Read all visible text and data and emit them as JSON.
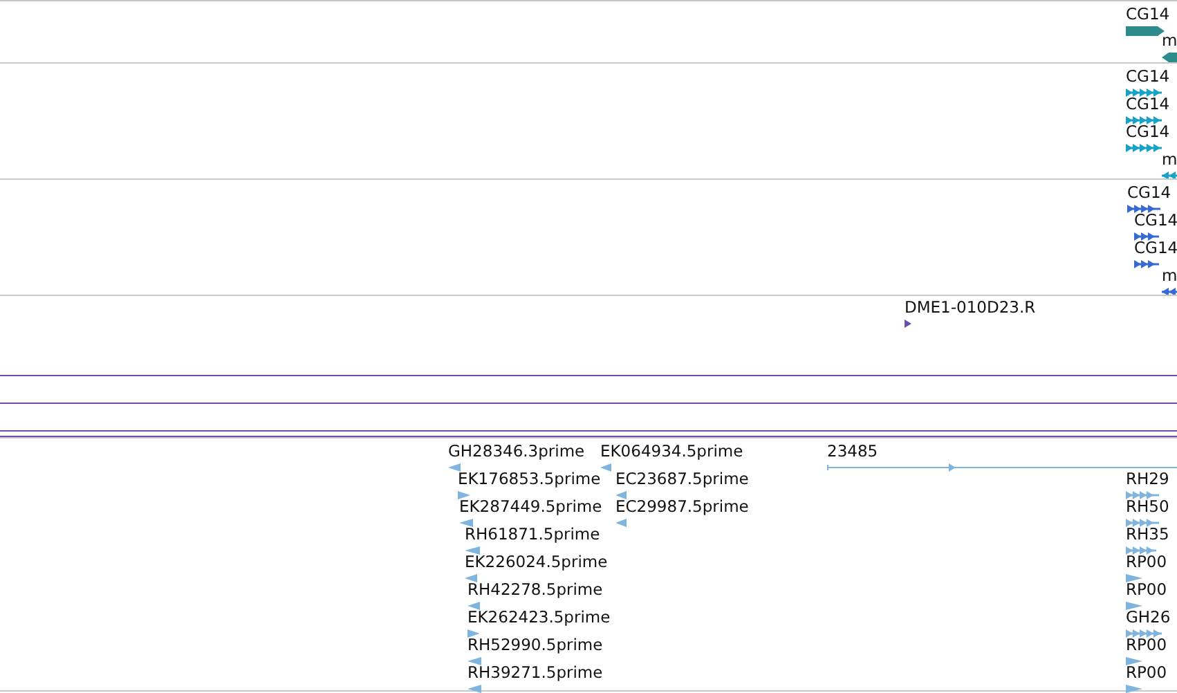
{
  "tracks": [
    {
      "kind": "features",
      "color": "#2e8b8b",
      "features": [
        {
          "label": "CG14",
          "reverse": false,
          "kind": "block"
        },
        {
          "label": "m",
          "reverse": true,
          "kind": "block"
        }
      ]
    },
    {
      "kind": "features",
      "color": "#17a3c7",
      "features": [
        {
          "label": "CG14",
          "reverse": false,
          "kind": "split"
        },
        {
          "label": "CG14",
          "reverse": false,
          "kind": "split"
        },
        {
          "label": "CG14",
          "reverse": false,
          "kind": "split"
        },
        {
          "label": "m",
          "reverse": true,
          "kind": "split"
        }
      ]
    },
    {
      "kind": "features",
      "color": "#3569d4",
      "features": [
        {
          "label": "CG14",
          "reverse": false,
          "kind": "split"
        },
        {
          "label": "CG14",
          "reverse": false,
          "kind": "split"
        },
        {
          "label": "CG14",
          "reverse": false,
          "kind": "split"
        },
        {
          "label": "m",
          "reverse": true,
          "kind": "split"
        }
      ]
    },
    {
      "kind": "features",
      "color": "#6a4fb0",
      "features": [
        {
          "label": "DME1-010D23.R",
          "reverse": false,
          "kind": "arrow"
        }
      ]
    },
    {
      "kind": "line",
      "color": "#6a4fb0"
    },
    {
      "kind": "line",
      "color": "#6a4fb0"
    },
    {
      "kind": "line",
      "color": "#6a4fb0"
    },
    {
      "kind": "line",
      "color": "#6a4fb0"
    },
    {
      "kind": "features",
      "color": "#7db5e0",
      "features": [
        {
          "label": "GH28346.3prime",
          "reverse": true,
          "kind": "arrow"
        },
        {
          "label": "EK176853.5prime",
          "reverse": false,
          "kind": "arrow"
        },
        {
          "label": "EK287449.5prime",
          "reverse": true,
          "kind": "arrow"
        },
        {
          "label": "RH61871.5prime",
          "reverse": true,
          "kind": "arrow"
        },
        {
          "label": "EK226024.5prime",
          "reverse": true,
          "kind": "arrow"
        },
        {
          "label": "RH42278.5prime",
          "reverse": true,
          "kind": "arrow"
        },
        {
          "label": "EK262423.5prime",
          "reverse": false,
          "kind": "arrow"
        },
        {
          "label": "RH52990.5prime",
          "reverse": true,
          "kind": "arrow"
        },
        {
          "label": "RH39271.5prime",
          "reverse": true,
          "kind": "arrow"
        },
        {
          "label": "EK064934.5prime",
          "reverse": true,
          "kind": "arrow"
        },
        {
          "label": "EC23687.5prime",
          "reverse": true,
          "kind": "arrow"
        },
        {
          "label": "EC29987.5prime",
          "reverse": true,
          "kind": "arrow"
        },
        {
          "label": "23485",
          "reverse": false,
          "kind": "line"
        },
        {
          "label": "RH29",
          "reverse": false,
          "kind": "split"
        },
        {
          "label": "RH50",
          "reverse": false,
          "kind": "split"
        },
        {
          "label": "RH35",
          "reverse": false,
          "kind": "split"
        },
        {
          "label": "RP00",
          "reverse": false,
          "kind": "arrow"
        },
        {
          "label": "RP00",
          "reverse": false,
          "kind": "arrow"
        },
        {
          "label": "GH26",
          "reverse": false,
          "kind": "split"
        },
        {
          "label": "RP00",
          "reverse": false,
          "kind": "arrow"
        },
        {
          "label": "RP00",
          "reverse": false,
          "kind": "arrow"
        }
      ]
    }
  ]
}
